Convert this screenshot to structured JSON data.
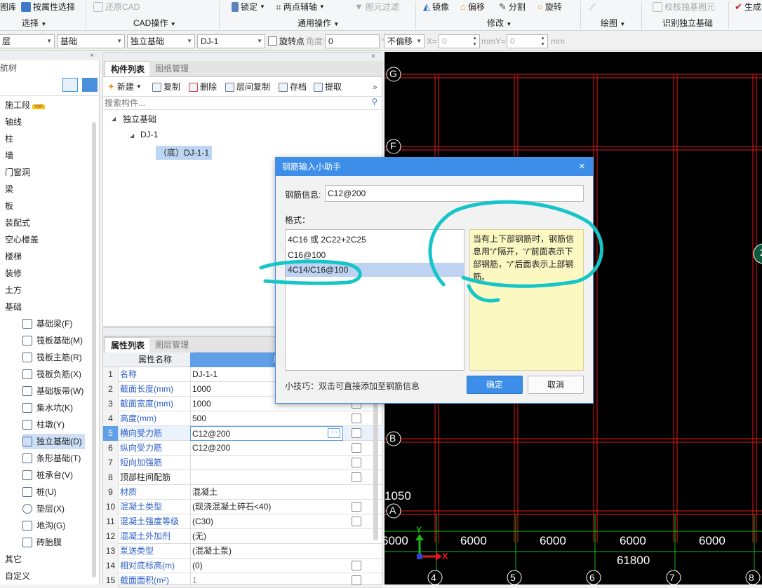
{
  "ribbon": {
    "attr_select": "按属性选择",
    "restore_cad": "还原CAD",
    "lock": "锁定",
    "two_point_axis": "两点辅轴",
    "element_filter": "图元过滤",
    "mirror": "镜像",
    "offset": "偏移",
    "split": "分割",
    "rotate": "旋转",
    "check_element": "校核独基图元",
    "generate": "生成",
    "left_cut": "图库",
    "groups": [
      "选择",
      "CAD操作",
      "通用操作",
      "修改",
      "绘图",
      "识别独立基础"
    ]
  },
  "propbar": {
    "floor": "层",
    "category": "基础",
    "type": "独立基础",
    "component": "DJ-1",
    "rotate_point": "旋转点",
    "angle_label": "角度:",
    "angle_value": "0",
    "degree": "°",
    "offset_mode": "不偏移",
    "x_label": "X=",
    "x_value": "0",
    "y_label": "mmY=",
    "y_value": "0",
    "mm": "mm"
  },
  "nav": {
    "title": "航树",
    "close": "×",
    "items": [
      "施工段",
      "轴线",
      "柱",
      "墙",
      "门窗洞",
      "梁",
      "板",
      "装配式",
      "空心楼盖",
      "楼梯",
      "装修",
      "土方",
      "基础"
    ],
    "vip": "VIP",
    "subitems": [
      "基础梁(F)",
      "筏板基础(M)",
      "筏板主筋(R)",
      "筏板负筋(X)",
      "基础板带(W)",
      "集水坑(K)",
      "柱墩(Y)",
      "独立基础(D)",
      "条形基础(T)",
      "桩承台(V)",
      "桩(U)",
      "垫层(X)",
      "地沟(G)",
      "砖胎膜"
    ],
    "tail": [
      "其它",
      "自定义"
    ]
  },
  "comp": {
    "tab_list": "构件列表",
    "tab_drawing": "图纸管理",
    "toolbar": [
      "新建",
      "复制",
      "删除",
      "层间复制",
      "存档",
      "提取"
    ],
    "more": "»",
    "search_placeholder": "搜索构件...",
    "tree": {
      "root": "独立基础",
      "child": "DJ-1",
      "leaf": "（底）DJ-1-1"
    },
    "close": "×"
  },
  "props": {
    "tab_list": "属性列表",
    "tab_layer": "图层管理",
    "col_name": "属性名称",
    "col_value": "属性值",
    "rows": [
      {
        "n": "1",
        "k": "名称",
        "v": "DJ-1-1",
        "cb": false
      },
      {
        "n": "2",
        "k": "截面长度(mm)",
        "v": "1000",
        "cb": true
      },
      {
        "n": "3",
        "k": "截面宽度(mm)",
        "v": "1000",
        "cb": true
      },
      {
        "n": "4",
        "k": "高度(mm)",
        "v": "500",
        "cb": true
      },
      {
        "n": "5",
        "k": "横向受力筋",
        "v": "C12@200",
        "cb": true
      },
      {
        "n": "6",
        "k": "纵向受力筋",
        "v": "C12@200",
        "cb": true
      },
      {
        "n": "7",
        "k": "短向加强筋",
        "v": "",
        "cb": true
      },
      {
        "n": "8",
        "k": "顶部柱间配筋",
        "v": "",
        "cb": true
      },
      {
        "n": "9",
        "k": "材质",
        "v": "混凝土",
        "cb": false
      },
      {
        "n": "10",
        "k": "混凝土类型",
        "v": "(现浇混凝土碎石<40)",
        "cb": true
      },
      {
        "n": "11",
        "k": "混凝土强度等级",
        "v": "(C30)",
        "cb": true
      },
      {
        "n": "12",
        "k": "混凝土外加剂",
        "v": "(无)",
        "cb": false
      },
      {
        "n": "13",
        "k": "泵送类型",
        "v": "(混凝土泵)",
        "cb": false
      },
      {
        "n": "14",
        "k": "相对底标高(m)",
        "v": "(0)",
        "cb": true
      },
      {
        "n": "15",
        "k": "截面面积(m²)",
        "v": "1",
        "cb": true
      }
    ]
  },
  "canvas": {
    "axis_labels_left": [
      "G",
      "F",
      "B",
      "A"
    ],
    "axis_labels_bottom": [
      "4",
      "5",
      "6",
      "7",
      "8"
    ],
    "dims": [
      "6000",
      "6000",
      "6000",
      "6000",
      "6000"
    ],
    "total": "61800",
    "dim_1050": "1050",
    "right_circle": "2",
    "x_axis": "X",
    "y_axis": "Y"
  },
  "dialog": {
    "title": "钢筋输入小助手",
    "close": "×",
    "info_label": "钢筋信息:",
    "info_value": "C12@200",
    "format_label": "格式：",
    "formats": [
      "4C16 或 2C22+2C25",
      "C16@100",
      "4C14/C16@100"
    ],
    "hint": "当有上下部钢筋时，钢筋信息用“/”隔开，“/”前面表示下部钢筋，“/”后面表示上部钢筋。",
    "tip": "小技巧：双击可直接添加至钢筋信息",
    "ok": "确定",
    "cancel": "取消"
  },
  "colors": {
    "accent": "#3c8ee8",
    "grid_red": "#e41a1a",
    "grid_green": "#1db51d",
    "annotation": "#16c5c8",
    "hint_bg": "#fbf8c2"
  }
}
